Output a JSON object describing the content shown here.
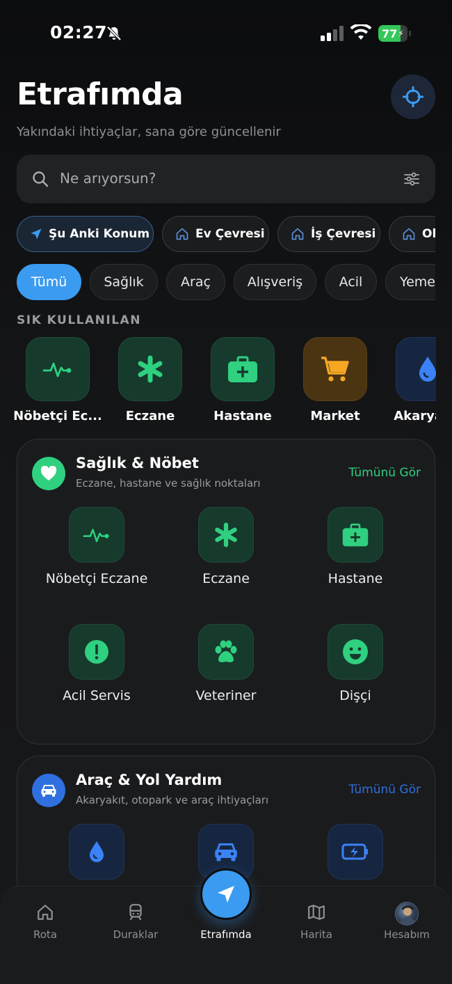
{
  "status_bar": {
    "time": "02:27",
    "battery_percent": "77",
    "battery_level": 0.77
  },
  "header": {
    "title": "Etrafımda",
    "subtitle": "Yakındaki ihtiyaçlar, sana göre güncellenir"
  },
  "search": {
    "placeholder": "Ne arıyorsun?"
  },
  "location_chips": [
    {
      "label": "Şu Anki Konum",
      "icon": "navigation-arrow-icon"
    },
    {
      "label": "Ev Çevresi",
      "icon": "home-icon"
    },
    {
      "label": "İş Çevresi",
      "icon": "home-icon"
    },
    {
      "label": "Okul Çevresi",
      "icon": "home-icon"
    }
  ],
  "category_chips": [
    "Tümü",
    "Sağlık",
    "Araç",
    "Alışveriş",
    "Acil",
    "Yemek"
  ],
  "favorites": {
    "label": "SIK KULLANILAN",
    "items": [
      {
        "label": "Nöbetçi Ec...",
        "icon": "pulse-icon",
        "color": "#2fd07f"
      },
      {
        "label": "Eczane",
        "icon": "asterisk-icon",
        "color": "#2fd07f"
      },
      {
        "label": "Hastane",
        "icon": "medkit-icon",
        "color": "#2fd07f"
      },
      {
        "label": "Market",
        "icon": "cart-icon",
        "color": "#f5a623"
      },
      {
        "label": "Akaryakıt",
        "icon": "fuel-drop-icon",
        "color": "#3b82f6"
      }
    ]
  },
  "health_card": {
    "title": "Sağlık & Nöbet",
    "description": "Eczane, hastane ve sağlık noktaları",
    "link": "Tümünü Gör",
    "accent": "#2fd07f",
    "tiles": [
      {
        "label": "Nöbetçi Eczane",
        "icon": "pulse-icon"
      },
      {
        "label": "Eczane",
        "icon": "asterisk-icon"
      },
      {
        "label": "Hastane",
        "icon": "medkit-icon"
      },
      {
        "label": "Acil Servis",
        "icon": "alert-icon"
      },
      {
        "label": "Veteriner",
        "icon": "paw-icon"
      },
      {
        "label": "Dişçi",
        "icon": "smile-icon"
      }
    ]
  },
  "car_card": {
    "title": "Araç & Yol Yardım",
    "description": "Akaryakıt, otopark ve araç ihtiyaçları",
    "link": "Tümünü Gör",
    "accent": "#2f6fe0",
    "tiles": [
      {
        "icon": "fuel-drop-icon"
      },
      {
        "icon": "car-icon"
      },
      {
        "icon": "battery-charge-icon"
      }
    ]
  },
  "tabbar": {
    "items": [
      {
        "label": "Rota",
        "icon": "home-icon"
      },
      {
        "label": "Duraklar",
        "icon": "train-icon"
      },
      {
        "label": "Etrafımda",
        "icon": "navigation-arrow-icon"
      },
      {
        "label": "Harita",
        "icon": "map-icon"
      },
      {
        "label": "Hesabım",
        "icon": "avatar-icon"
      }
    ],
    "active": "Etrafımda"
  },
  "colors": {
    "accent_blue": "#3b9bf1",
    "green": "#2fd07f",
    "orange": "#f5a623",
    "background": "#111214"
  }
}
